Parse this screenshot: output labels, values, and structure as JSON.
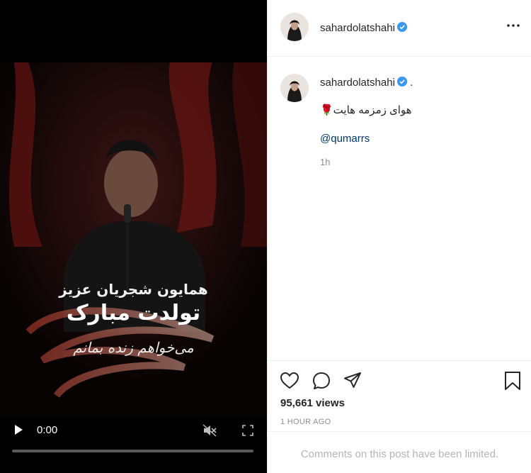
{
  "video": {
    "overlay_line1": "همایون شجریان عزیز",
    "overlay_line2": "تولدت مبارک",
    "overlay_line3": "می‌خواهم زنده بمانم",
    "time": "0:00",
    "progress_fraction": 0.0
  },
  "header": {
    "username": "sahardolatshahi",
    "more_icon": "more-options-icon"
  },
  "caption": {
    "username": "sahardolatshahi",
    "dot": ".",
    "text": "هوای زمزمه هایت🌹",
    "mention": "@qumarrs",
    "time_ago": "1h"
  },
  "actions": {
    "views": "95,661 views",
    "posted": "1 HOUR AGO"
  },
  "comments": {
    "notice": "Comments on this post have been limited."
  },
  "colors": {
    "verified": "#3897f0",
    "mention": "#00376b",
    "muted": "#8e8e8e"
  }
}
